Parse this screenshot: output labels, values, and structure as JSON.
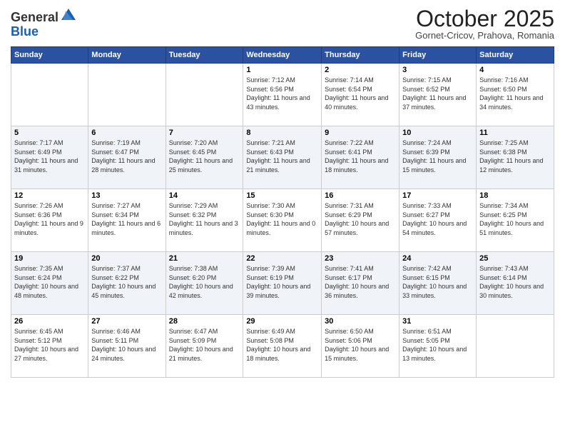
{
  "logo": {
    "general": "General",
    "blue": "Blue"
  },
  "header": {
    "month": "October 2025",
    "location": "Gornet-Cricov, Prahova, Romania"
  },
  "days_of_week": [
    "Sunday",
    "Monday",
    "Tuesday",
    "Wednesday",
    "Thursday",
    "Friday",
    "Saturday"
  ],
  "weeks": [
    [
      {
        "day": "",
        "info": ""
      },
      {
        "day": "",
        "info": ""
      },
      {
        "day": "",
        "info": ""
      },
      {
        "day": "1",
        "info": "Sunrise: 7:12 AM\nSunset: 6:56 PM\nDaylight: 11 hours and 43 minutes."
      },
      {
        "day": "2",
        "info": "Sunrise: 7:14 AM\nSunset: 6:54 PM\nDaylight: 11 hours and 40 minutes."
      },
      {
        "day": "3",
        "info": "Sunrise: 7:15 AM\nSunset: 6:52 PM\nDaylight: 11 hours and 37 minutes."
      },
      {
        "day": "4",
        "info": "Sunrise: 7:16 AM\nSunset: 6:50 PM\nDaylight: 11 hours and 34 minutes."
      }
    ],
    [
      {
        "day": "5",
        "info": "Sunrise: 7:17 AM\nSunset: 6:49 PM\nDaylight: 11 hours and 31 minutes."
      },
      {
        "day": "6",
        "info": "Sunrise: 7:19 AM\nSunset: 6:47 PM\nDaylight: 11 hours and 28 minutes."
      },
      {
        "day": "7",
        "info": "Sunrise: 7:20 AM\nSunset: 6:45 PM\nDaylight: 11 hours and 25 minutes."
      },
      {
        "day": "8",
        "info": "Sunrise: 7:21 AM\nSunset: 6:43 PM\nDaylight: 11 hours and 21 minutes."
      },
      {
        "day": "9",
        "info": "Sunrise: 7:22 AM\nSunset: 6:41 PM\nDaylight: 11 hours and 18 minutes."
      },
      {
        "day": "10",
        "info": "Sunrise: 7:24 AM\nSunset: 6:39 PM\nDaylight: 11 hours and 15 minutes."
      },
      {
        "day": "11",
        "info": "Sunrise: 7:25 AM\nSunset: 6:38 PM\nDaylight: 11 hours and 12 minutes."
      }
    ],
    [
      {
        "day": "12",
        "info": "Sunrise: 7:26 AM\nSunset: 6:36 PM\nDaylight: 11 hours and 9 minutes."
      },
      {
        "day": "13",
        "info": "Sunrise: 7:27 AM\nSunset: 6:34 PM\nDaylight: 11 hours and 6 minutes."
      },
      {
        "day": "14",
        "info": "Sunrise: 7:29 AM\nSunset: 6:32 PM\nDaylight: 11 hours and 3 minutes."
      },
      {
        "day": "15",
        "info": "Sunrise: 7:30 AM\nSunset: 6:30 PM\nDaylight: 11 hours and 0 minutes."
      },
      {
        "day": "16",
        "info": "Sunrise: 7:31 AM\nSunset: 6:29 PM\nDaylight: 10 hours and 57 minutes."
      },
      {
        "day": "17",
        "info": "Sunrise: 7:33 AM\nSunset: 6:27 PM\nDaylight: 10 hours and 54 minutes."
      },
      {
        "day": "18",
        "info": "Sunrise: 7:34 AM\nSunset: 6:25 PM\nDaylight: 10 hours and 51 minutes."
      }
    ],
    [
      {
        "day": "19",
        "info": "Sunrise: 7:35 AM\nSunset: 6:24 PM\nDaylight: 10 hours and 48 minutes."
      },
      {
        "day": "20",
        "info": "Sunrise: 7:37 AM\nSunset: 6:22 PM\nDaylight: 10 hours and 45 minutes."
      },
      {
        "day": "21",
        "info": "Sunrise: 7:38 AM\nSunset: 6:20 PM\nDaylight: 10 hours and 42 minutes."
      },
      {
        "day": "22",
        "info": "Sunrise: 7:39 AM\nSunset: 6:19 PM\nDaylight: 10 hours and 39 minutes."
      },
      {
        "day": "23",
        "info": "Sunrise: 7:41 AM\nSunset: 6:17 PM\nDaylight: 10 hours and 36 minutes."
      },
      {
        "day": "24",
        "info": "Sunrise: 7:42 AM\nSunset: 6:15 PM\nDaylight: 10 hours and 33 minutes."
      },
      {
        "day": "25",
        "info": "Sunrise: 7:43 AM\nSunset: 6:14 PM\nDaylight: 10 hours and 30 minutes."
      }
    ],
    [
      {
        "day": "26",
        "info": "Sunrise: 6:45 AM\nSunset: 5:12 PM\nDaylight: 10 hours and 27 minutes."
      },
      {
        "day": "27",
        "info": "Sunrise: 6:46 AM\nSunset: 5:11 PM\nDaylight: 10 hours and 24 minutes."
      },
      {
        "day": "28",
        "info": "Sunrise: 6:47 AM\nSunset: 5:09 PM\nDaylight: 10 hours and 21 minutes."
      },
      {
        "day": "29",
        "info": "Sunrise: 6:49 AM\nSunset: 5:08 PM\nDaylight: 10 hours and 18 minutes."
      },
      {
        "day": "30",
        "info": "Sunrise: 6:50 AM\nSunset: 5:06 PM\nDaylight: 10 hours and 15 minutes."
      },
      {
        "day": "31",
        "info": "Sunrise: 6:51 AM\nSunset: 5:05 PM\nDaylight: 10 hours and 13 minutes."
      },
      {
        "day": "",
        "info": ""
      }
    ]
  ]
}
